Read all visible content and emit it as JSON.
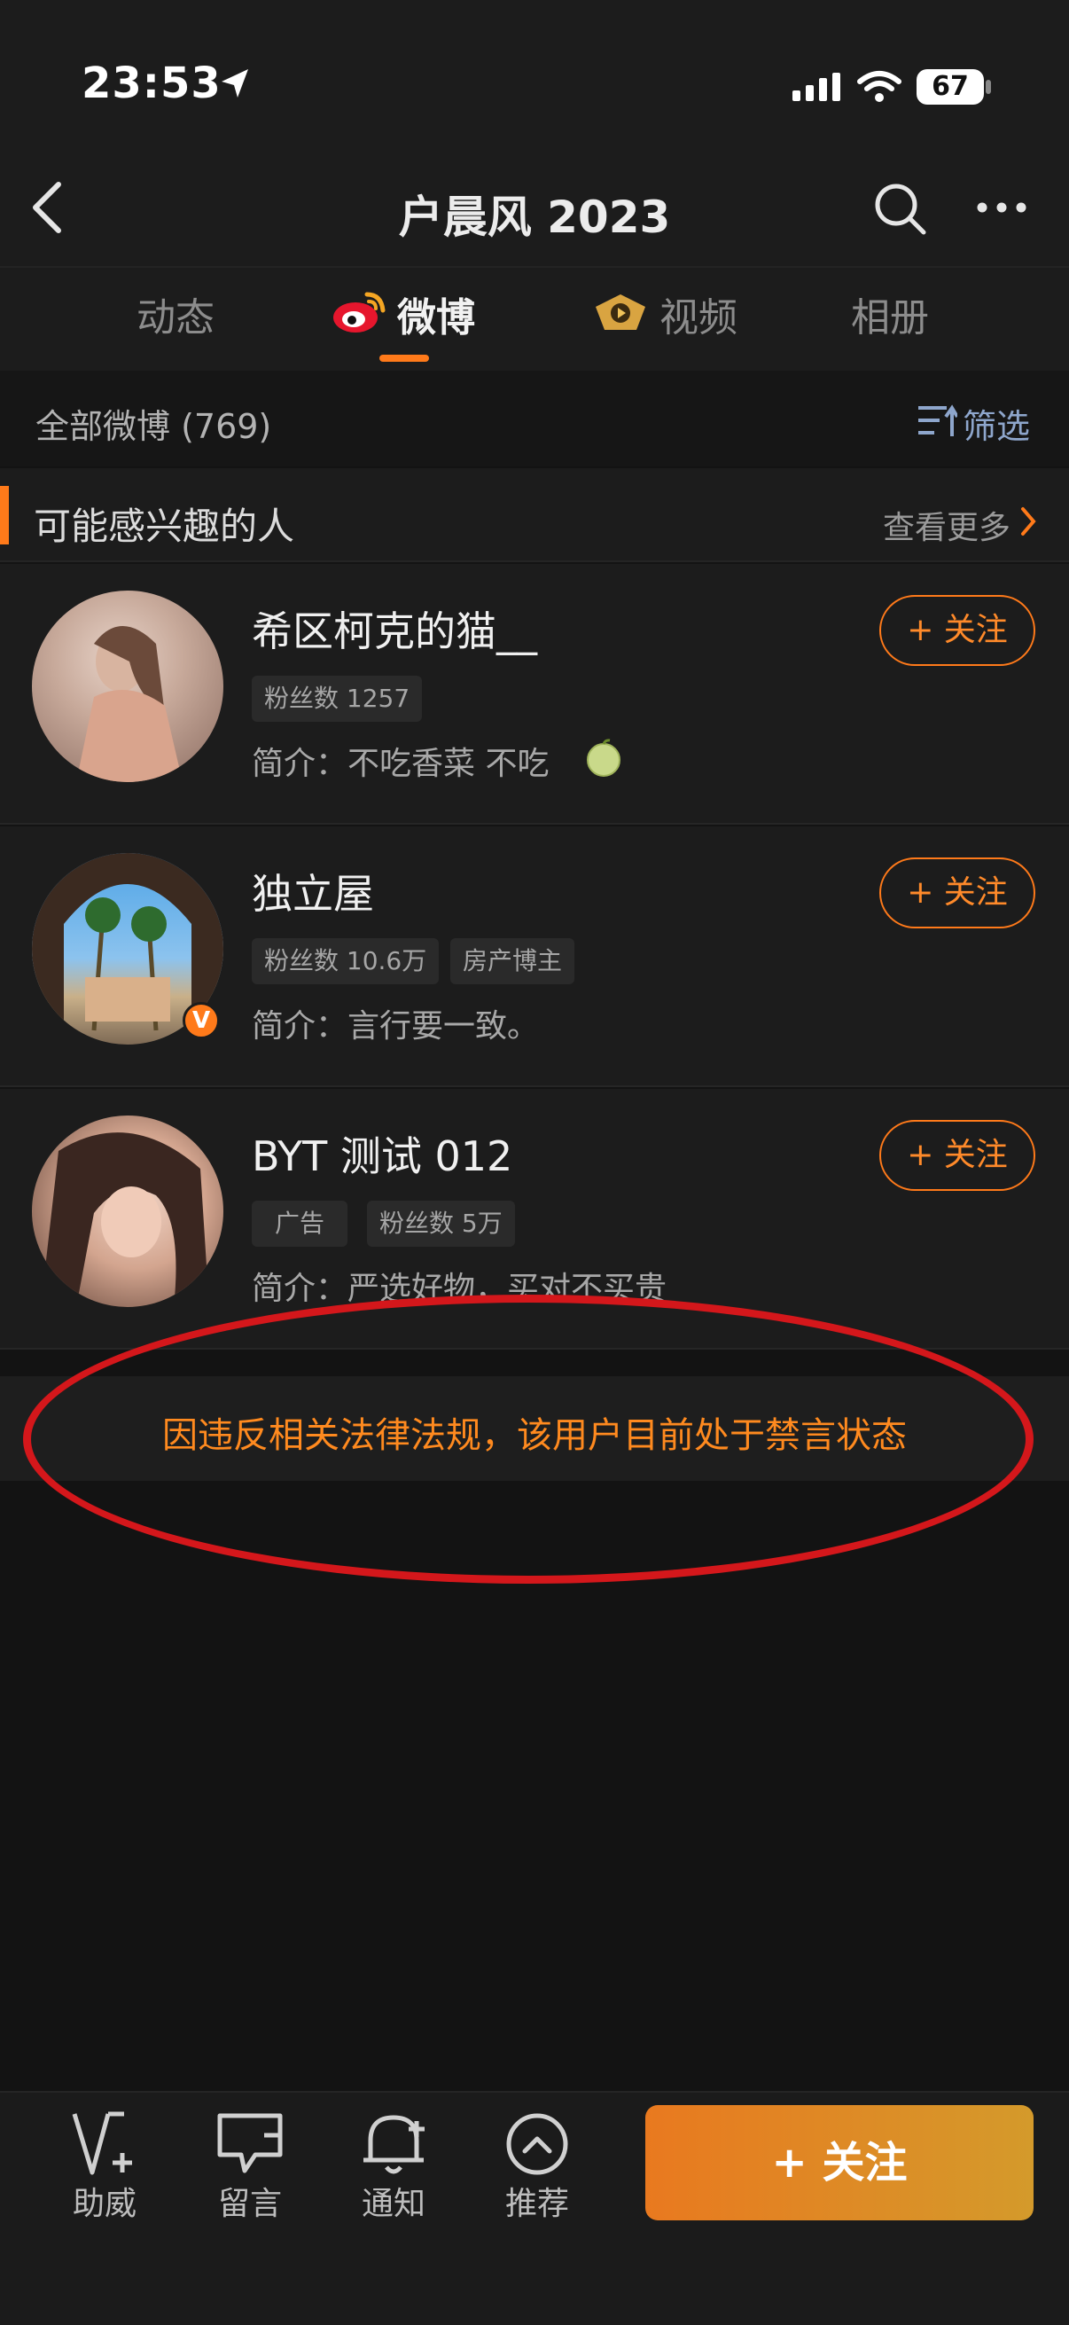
{
  "status_bar": {
    "time": "23:53",
    "battery": "67"
  },
  "nav": {
    "title": "户晨风 2023",
    "back_icon": "chevron-left-icon",
    "search_icon": "search-icon",
    "more_icon": "more-icon"
  },
  "tabs": [
    {
      "label": "动态",
      "icon": ""
    },
    {
      "label": "微博",
      "icon": "weibo-logo-icon"
    },
    {
      "label": "视频",
      "icon": "video-badge-icon"
    },
    {
      "label": "相册",
      "icon": ""
    }
  ],
  "filter_bar": {
    "count_label": "全部微博 (769)",
    "filter_label": "筛选"
  },
  "recommend": {
    "title": "可能感兴趣的人",
    "more_label": "查看更多"
  },
  "people": [
    {
      "name": "希区柯克的猫__",
      "tags": [
        "粉丝数 1257"
      ],
      "intro": "简介：不吃香菜  不吃",
      "follow_label": "+ 关注"
    },
    {
      "name": "独立屋",
      "tags": [
        "粉丝数 10.6万",
        "房产博主"
      ],
      "intro": "简介：言行要一致。",
      "follow_label": "+ 关注"
    },
    {
      "name": "BYT 测试 012",
      "tags": [
        "广告",
        "粉丝数 5万"
      ],
      "intro": "简介：严选好物，买对不买贵",
      "follow_label": "+ 关注"
    }
  ],
  "notice": {
    "text": "因违反相关法律法规，该用户目前处于禁言状态"
  },
  "bottom_bar": {
    "items": [
      {
        "label": "助威",
        "icon": "cheer-v-icon"
      },
      {
        "label": "留言",
        "icon": "message-icon"
      },
      {
        "label": "通知",
        "icon": "bell-icon"
      },
      {
        "label": "推荐",
        "icon": "recommend-icon"
      }
    ],
    "follow_label": "+ 关注"
  },
  "colors": {
    "accent": "#ff7a1a",
    "highlight_ellipse": "#d4171b",
    "background": "#131313"
  }
}
